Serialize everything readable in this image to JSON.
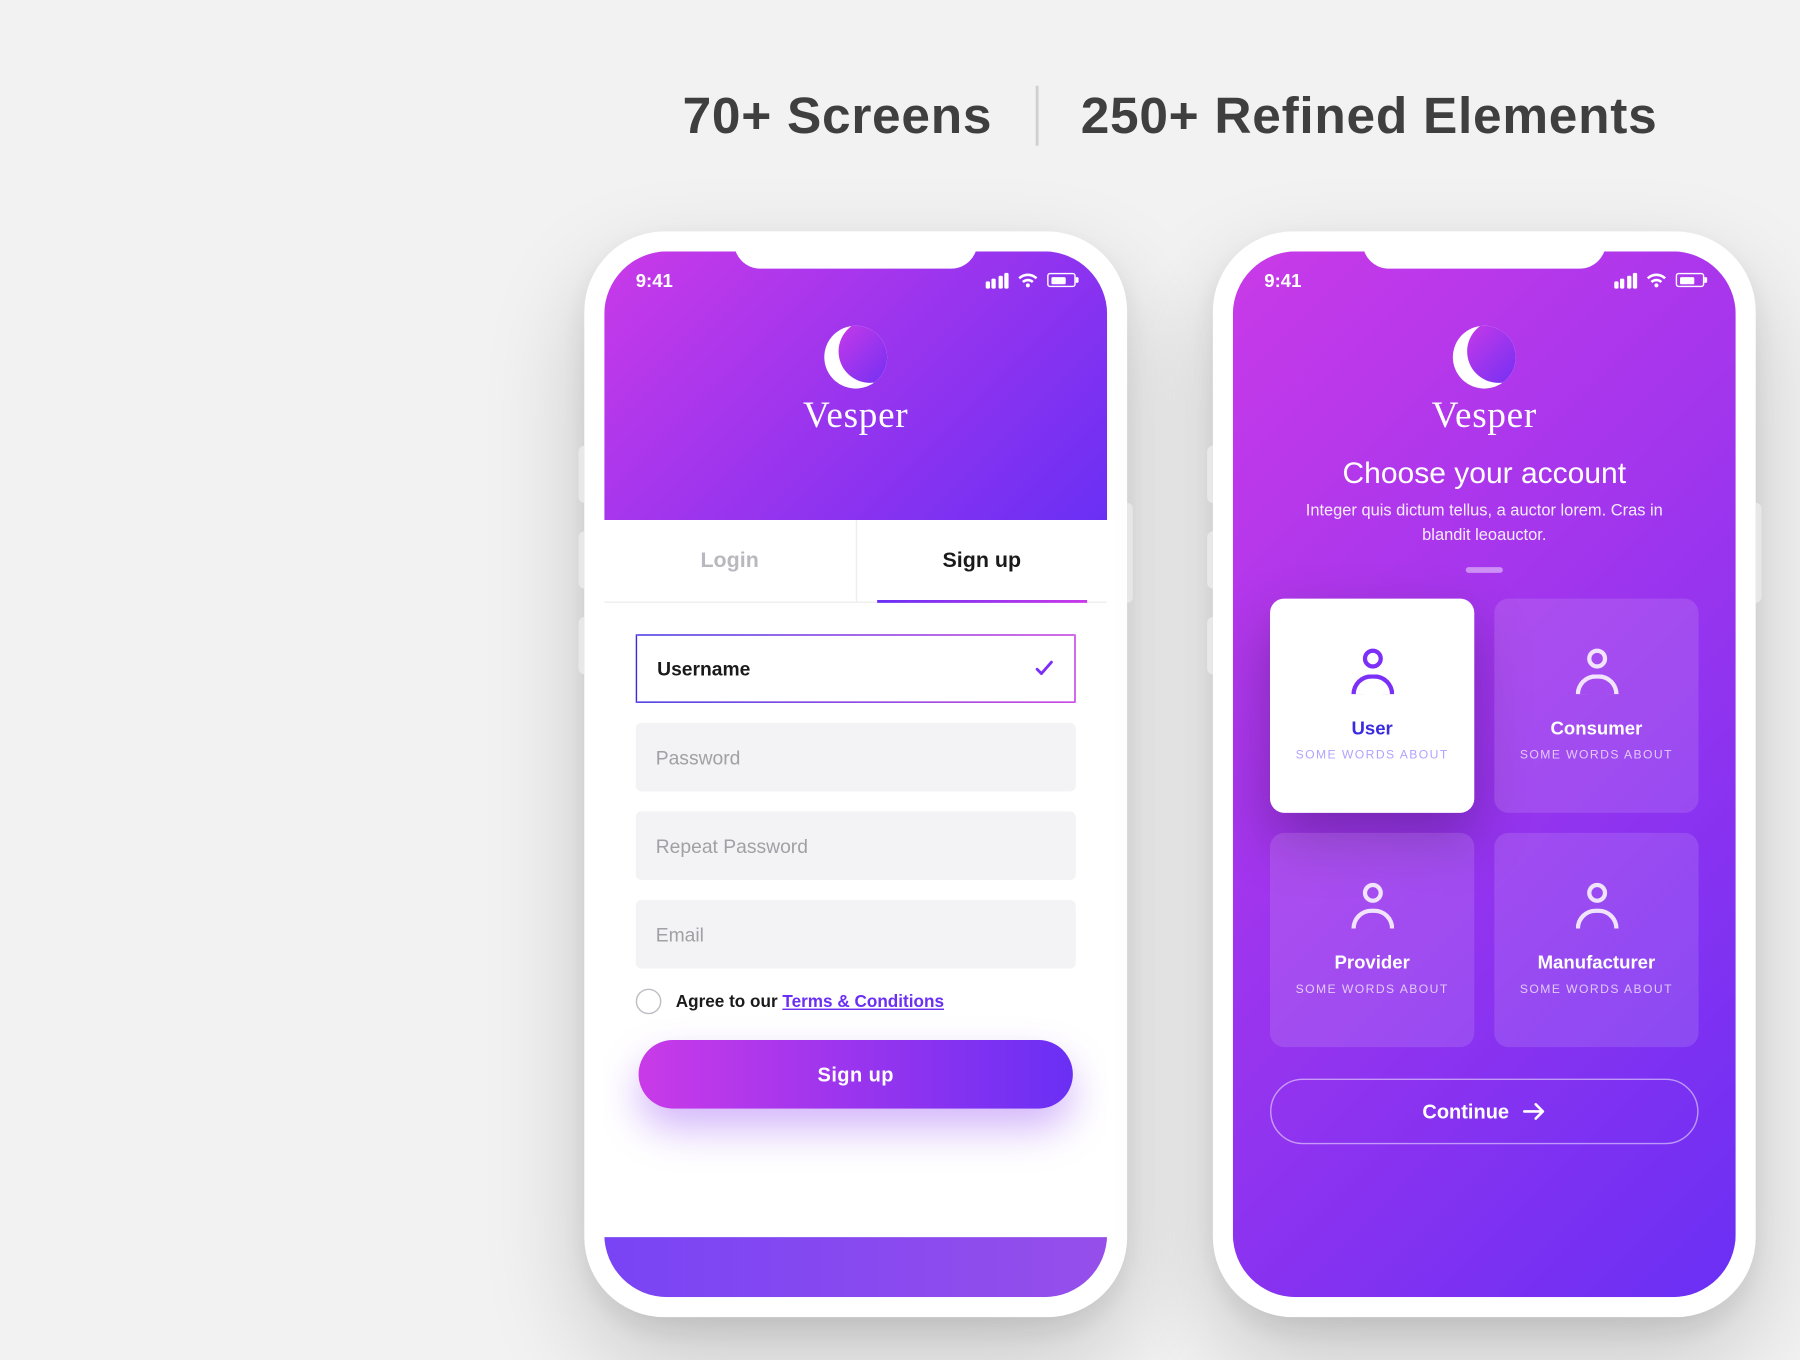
{
  "headline": {
    "left": "70+ Screens",
    "right": "250+ Refined Elements"
  },
  "brand": {
    "name": "Vesper"
  },
  "status": {
    "time": "9:41"
  },
  "screen_signup": {
    "tabs": {
      "login": "Login",
      "signup": "Sign up"
    },
    "fields": {
      "username": "Username",
      "password": "Password",
      "repeat_password": "Repeat Password",
      "email": "Email"
    },
    "agree_prefix": "Agree to our ",
    "agree_link": "Terms & Conditions",
    "submit": "Sign up"
  },
  "screen_choose": {
    "title": "Choose your account",
    "subtitle": "Integer quis dictum tellus, a auctor lorem. Cras in blandit leoauctor.",
    "cards": [
      {
        "title": "User",
        "desc": "SOME WORDS ABOUT",
        "selected": true
      },
      {
        "title": "Consumer",
        "desc": "SOME WORDS ABOUT",
        "selected": false
      },
      {
        "title": "Provider",
        "desc": "SOME WORDS ABOUT",
        "selected": false
      },
      {
        "title": "Manufacturer",
        "desc": "SOME WORDS ABOUT",
        "selected": false
      }
    ],
    "continue": "Continue"
  },
  "colors": {
    "gradient_start": "#c93ae8",
    "gradient_end": "#6a2ff4",
    "accent": "#7b2ff7"
  }
}
